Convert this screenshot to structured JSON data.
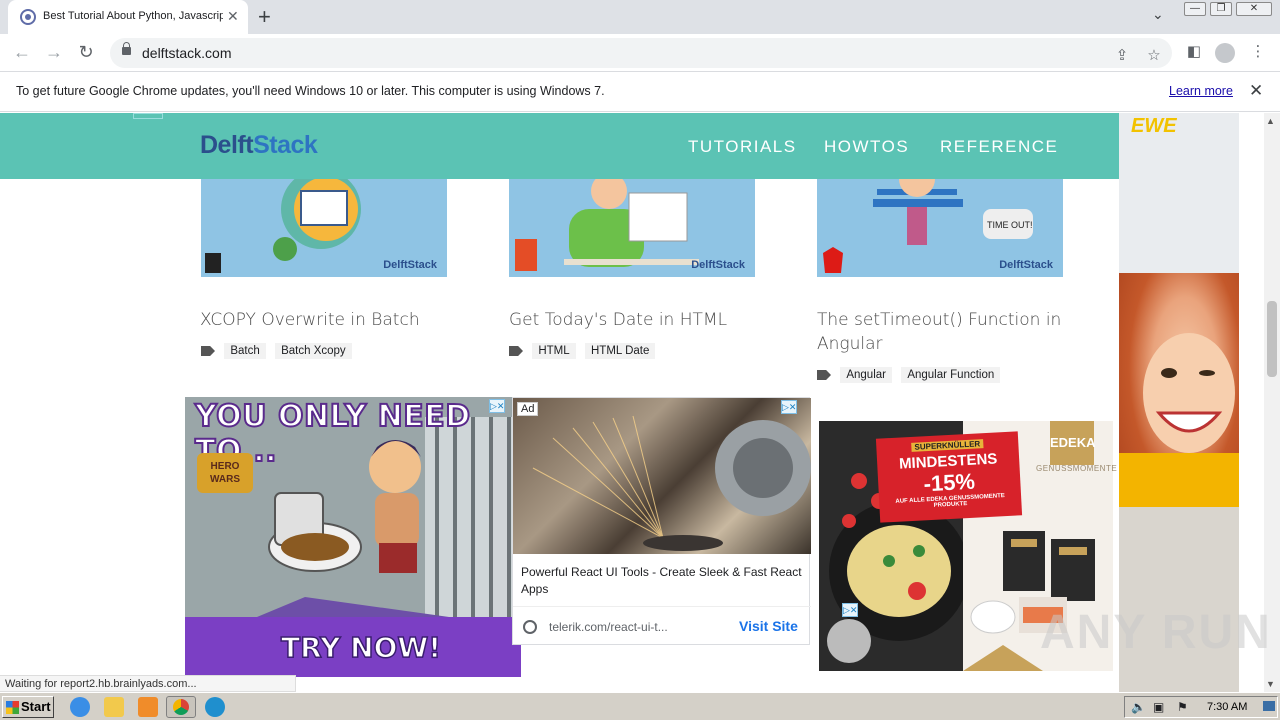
{
  "browser": {
    "tab_title": "Best Tutorial About Python, Javascript",
    "tab_close": "✕",
    "new_tab": "+",
    "tab_search": "⌄",
    "window_controls": [
      "—",
      "❐",
      "✕"
    ],
    "url": "delftstack.com",
    "nav": {
      "back": "←",
      "forward": "→",
      "reload": "↻"
    },
    "toolbar_icons": {
      "share": "⇪",
      "bookmark": "☆",
      "sidepanel": "◧",
      "menu": "⋮"
    }
  },
  "infobar": {
    "message": "To get future Google Chrome updates, you'll need Windows 10 or later. This computer is using Windows 7.",
    "link": "Learn more",
    "close": "✕"
  },
  "site": {
    "logo_part1": "Delft",
    "logo_part2": "Stack",
    "nav": [
      "TUTORIALS",
      "HOWTOS",
      "REFERENCE"
    ]
  },
  "articles": [
    {
      "title": "XCOPY Overwrite in Batch",
      "tags": [
        "Batch",
        "Batch Xcopy"
      ],
      "brand": "DelftStack",
      "thumb_color": "#8fc4e4"
    },
    {
      "title": "Get Today's Date in HTML",
      "tags": [
        "HTML",
        "HTML Date"
      ],
      "brand": "DelftStack",
      "thumb_color": "#8fc4e4"
    },
    {
      "title": "The setTimeout() Function in Angular",
      "tags": [
        "Angular",
        "Angular Function"
      ],
      "brand": "DelftStack",
      "thumb_color": "#8fc4e4"
    }
  ],
  "ads": {
    "herowars": {
      "headline": "YOU ONLY NEED TO...",
      "cta": "TRY NOW!",
      "logo": "HERO WARS"
    },
    "telerik": {
      "label": "Ad",
      "description": "Powerful React UI Tools - Create Sleek & Fast React Apps",
      "domain": "telerik.com/react-ui-t...",
      "cta": "Visit Site"
    },
    "edeka": {
      "brand": "EDEKA",
      "tagline": "GENUSSMOMENTE",
      "promo_top": "SUPERKNÜLLER",
      "promo_main": "MINDESTENS",
      "promo_pct": "-15%",
      "promo_fine": "AUF ALLE EDEKA GENUSSMOMENTE PRODUKTE"
    },
    "ewe": {
      "brand": "EWE"
    },
    "adchoice": "▷✕"
  },
  "status_text": "Waiting for report2.hb.brainlyads.com...",
  "watermark": "ANY RUN",
  "taskbar": {
    "start": "Start",
    "clock": "7:30 AM"
  }
}
